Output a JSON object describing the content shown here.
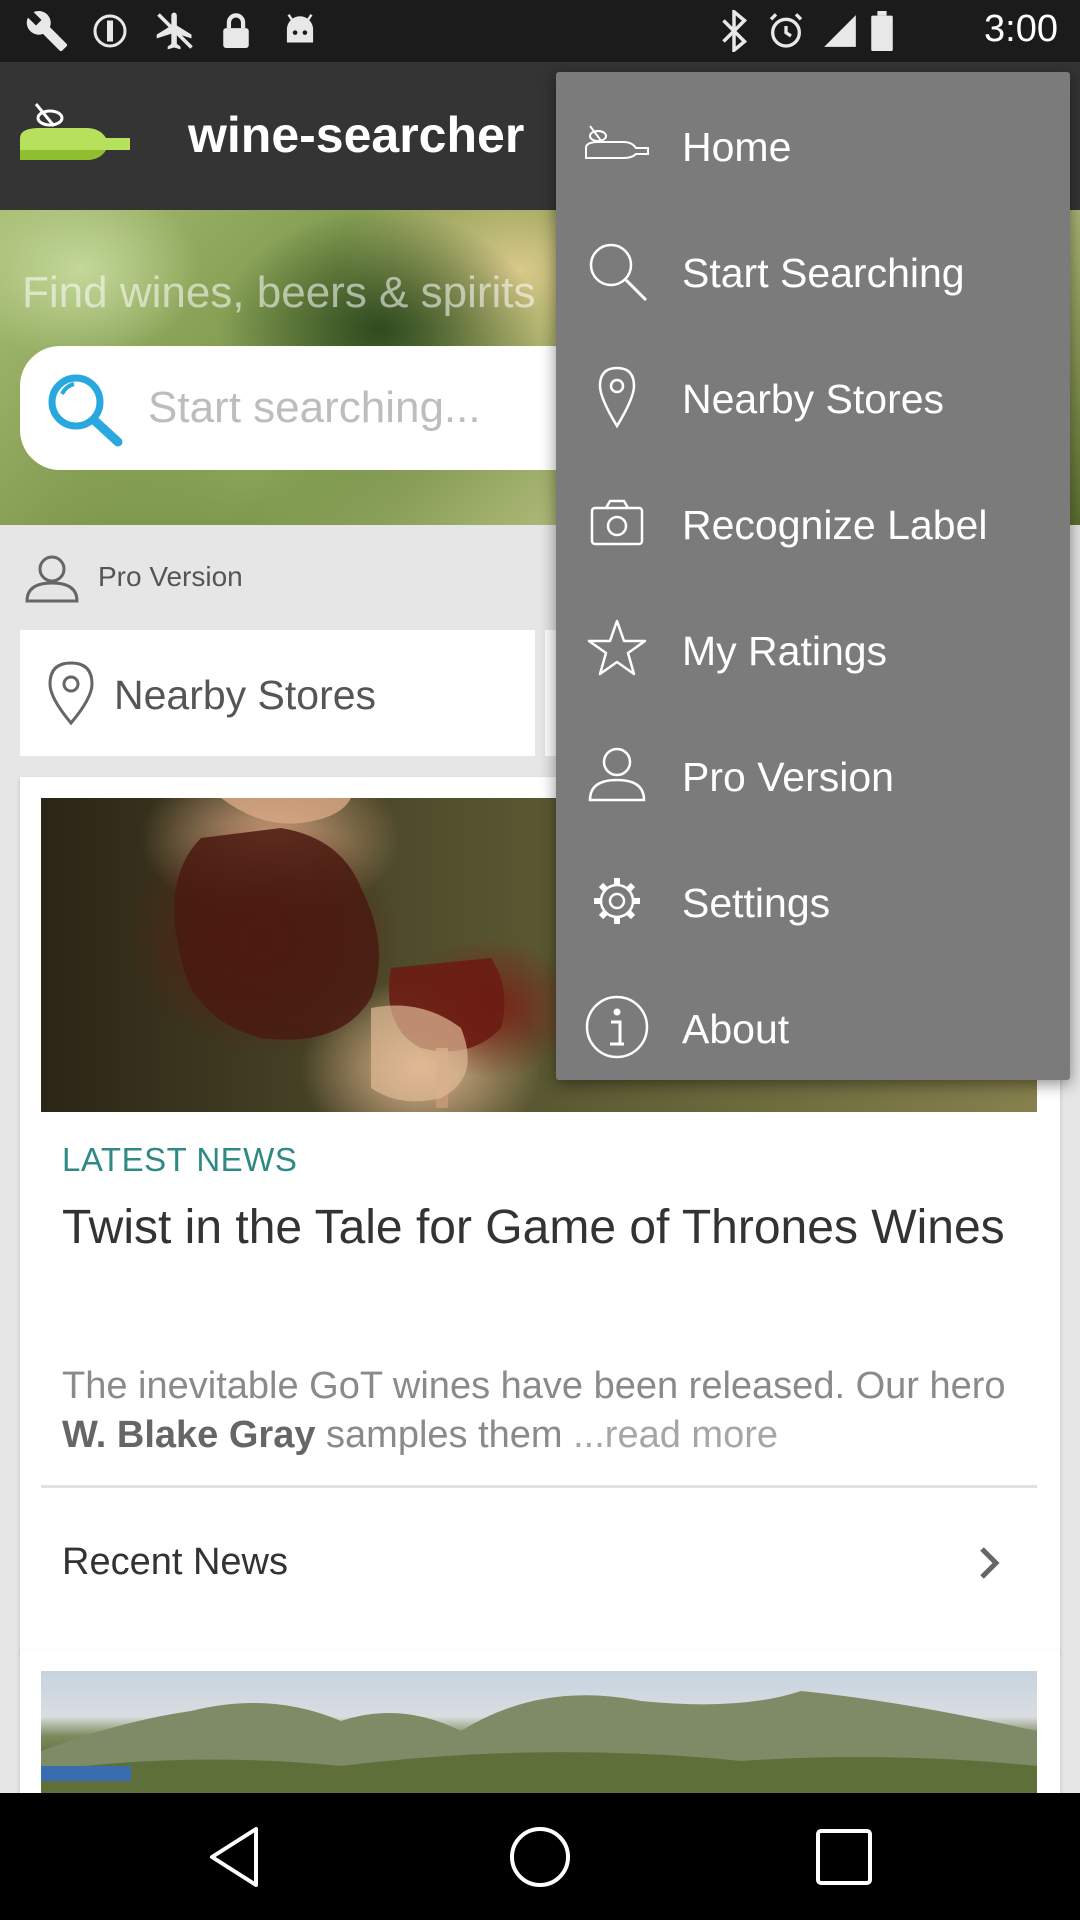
{
  "status_bar": {
    "time": "3:00",
    "left_icons": [
      "wrench-icon",
      "no-sim-icon",
      "no-signal-plane-icon",
      "lock-icon",
      "android-icon"
    ],
    "right_icons": [
      "bluetooth-icon",
      "alarm-icon",
      "signal-icon",
      "battery-icon"
    ]
  },
  "app_bar": {
    "title": "wine-searcher",
    "logo_icon": "wine-bottle-logo-icon"
  },
  "hero": {
    "tagline": "Find wines, beers & spirits",
    "search_placeholder": "Start searching..."
  },
  "content": {
    "pro_version_label": "Pro Version",
    "nearby_stores_label": "Nearby Stores",
    "news": {
      "category": "LATEST NEWS",
      "title": "Twist in the Tale for Game of Thrones Wines",
      "excerpt_start": "The inevitable GoT wines have been released. Our hero ",
      "excerpt_author": "W. Blake Gray",
      "excerpt_end": " samples them ",
      "read_more": "...read more",
      "recent_label": "Recent News"
    }
  },
  "menu": {
    "items": [
      {
        "label": "Home",
        "icon": "wine-bottle-icon"
      },
      {
        "label": "Start Searching",
        "icon": "search-icon"
      },
      {
        "label": "Nearby Stores",
        "icon": "location-pin-icon"
      },
      {
        "label": "Recognize Label",
        "icon": "camera-icon"
      },
      {
        "label": "My Ratings",
        "icon": "star-icon"
      },
      {
        "label": "Pro Version",
        "icon": "person-icon"
      },
      {
        "label": "Settings",
        "icon": "gear-icon"
      },
      {
        "label": "About",
        "icon": "info-icon"
      }
    ]
  },
  "colors": {
    "app_bar": "#343434",
    "menu_bg": "#7b7b7b",
    "accent_teal": "#2f8a84",
    "search_blue": "#29a8e0"
  }
}
